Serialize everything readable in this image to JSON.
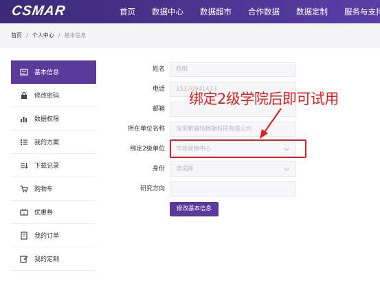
{
  "header": {
    "logo": "CSMAR",
    "nav": [
      "首页",
      "数据中心",
      "数据超市",
      "合作数据",
      "数据定制",
      "服务与支持"
    ]
  },
  "breadcrumb": {
    "items": [
      "首页",
      "个人中心",
      "基本信息"
    ],
    "separator": "/"
  },
  "sidebar": {
    "items": [
      {
        "label": "基本信息",
        "icon": "profile-card-icon",
        "active": true
      },
      {
        "label": "修改密码",
        "icon": "lock-icon"
      },
      {
        "label": "数据权限",
        "icon": "bar-chart-icon"
      },
      {
        "label": "我的方案",
        "icon": "list-icon"
      },
      {
        "label": "下载记录",
        "icon": "download-list-icon"
      },
      {
        "label": "购物车",
        "icon": "cart-icon"
      },
      {
        "label": "优惠券",
        "icon": "coupon-icon"
      },
      {
        "label": "我的订单",
        "icon": "order-icon"
      },
      {
        "label": "我的定制",
        "icon": "edit-icon"
      }
    ]
  },
  "form": {
    "name_label": "姓名",
    "name_value": "杨阳",
    "phone_label": "电话",
    "phone_value": "15370941473",
    "email_label": "邮箱",
    "email_value": "",
    "org_label": "所在单位名称",
    "org_value": "深圳希施玛数据科技有限公司",
    "dept_label": "绑定2级单位",
    "dept_value": "市场营销中心",
    "role_label": "身份",
    "role_placeholder": "请选择",
    "research_label": "研究方向",
    "research_value": "",
    "submit_label": "修改基本信息"
  },
  "annotation": {
    "text": "绑定2级学院后即可试用",
    "color": "#e02020"
  },
  "colors": {
    "header": "#3b2a78",
    "accent": "#5a3a9a",
    "annotation": "#e02020"
  }
}
